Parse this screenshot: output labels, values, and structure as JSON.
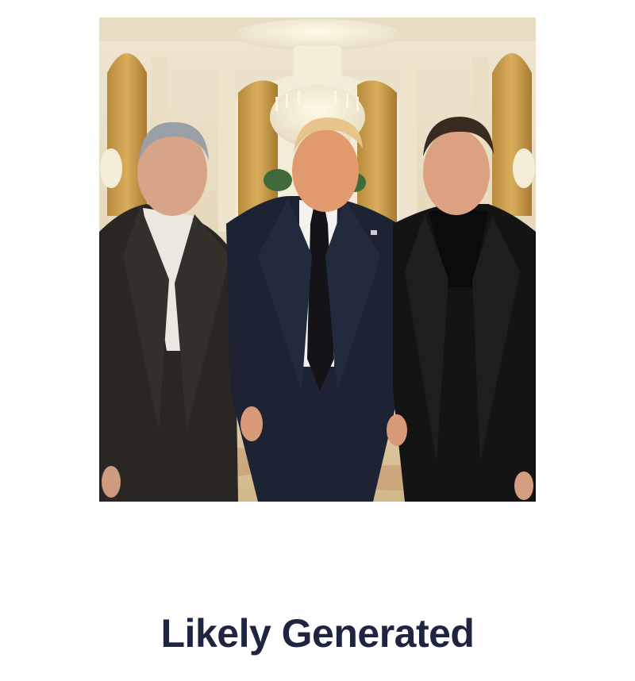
{
  "result": {
    "label": "Likely Generated"
  },
  "colors": {
    "label_text": "#1e2540",
    "background": "#ffffff"
  },
  "image": {
    "icon": "analyzed-photo"
  }
}
